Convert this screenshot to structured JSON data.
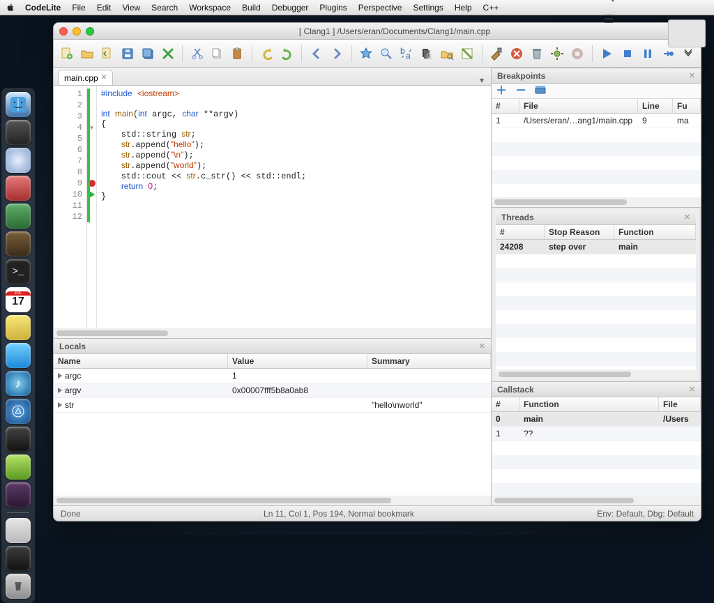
{
  "menubar": {
    "app": "CodeLite",
    "items": [
      "File",
      "Edit",
      "View",
      "Search",
      "Workspace",
      "Build",
      "Debugger",
      "Plugins",
      "Perspective",
      "Settings",
      "Help",
      "C++"
    ]
  },
  "window": {
    "title": "[ Clang1 ] /Users/eran/Documents/Clang1/main.cpp"
  },
  "tab": {
    "label": "main.cpp"
  },
  "code": {
    "lines": [
      {
        "n": 1,
        "html": "<span class='kw'>#include</span> <span class='inc'>&lt;iostream&gt;</span>"
      },
      {
        "n": 2,
        "html": ""
      },
      {
        "n": 3,
        "html": "<span class='type'>int</span> <span class='fn'>main</span>(<span class='type'>int</span> argc, <span class='type'>char</span> **argv)"
      },
      {
        "n": 4,
        "html": "{",
        "fold": true
      },
      {
        "n": 5,
        "html": "    std::string <span class='var'>str</span>;"
      },
      {
        "n": 6,
        "html": "    <span class='var'>str</span>.append(<span class='str'>\"hello\"</span>);"
      },
      {
        "n": 7,
        "html": "    <span class='var'>str</span>.append(<span class='str'>\"\\n\"</span>);"
      },
      {
        "n": 8,
        "html": "    <span class='var'>str</span>.append(<span class='str'>\"world\"</span>);"
      },
      {
        "n": 9,
        "html": "    std::cout << <span class='var'>str</span>.c_str() << std::endl;",
        "bp": true
      },
      {
        "n": 10,
        "html": "    <span class='kw'>return</span> <span class='num'>0</span>;",
        "current": true
      },
      {
        "n": 11,
        "html": "}"
      },
      {
        "n": 12,
        "html": ""
      }
    ]
  },
  "locals": {
    "title": "Locals",
    "cols": [
      "Name",
      "Value",
      "Summary"
    ],
    "rows": [
      {
        "name": "argc",
        "value": "1",
        "summary": ""
      },
      {
        "name": "argv",
        "value": "0x00007fff5b8a0ab8",
        "summary": ""
      },
      {
        "name": "str",
        "value": "",
        "summary": "\"hello\\nworld\""
      }
    ]
  },
  "breakpoints": {
    "title": "Breakpoints",
    "cols": [
      "#",
      "File",
      "Line",
      "Fu"
    ],
    "rows": [
      {
        "n": "1",
        "file": "/Users/eran/…ang1/main.cpp",
        "line": "9",
        "fun": "ma"
      }
    ]
  },
  "threads": {
    "title": "Threads",
    "cols": [
      "#",
      "Stop Reason",
      "Function"
    ],
    "rows": [
      {
        "n": "24208",
        "reason": "step over",
        "fn": "main"
      }
    ]
  },
  "callstack": {
    "title": "Callstack",
    "cols": [
      "#",
      "Function",
      "File"
    ],
    "rows": [
      {
        "n": "0",
        "fn": "main",
        "file": "/Users"
      },
      {
        "n": "1",
        "fn": "??",
        "file": ""
      }
    ]
  },
  "status": {
    "left": "Done",
    "mid": "Ln 11,  Col 1,  Pos 194, Normal bookmark",
    "right": "Env: Default, Dbg: Default"
  }
}
